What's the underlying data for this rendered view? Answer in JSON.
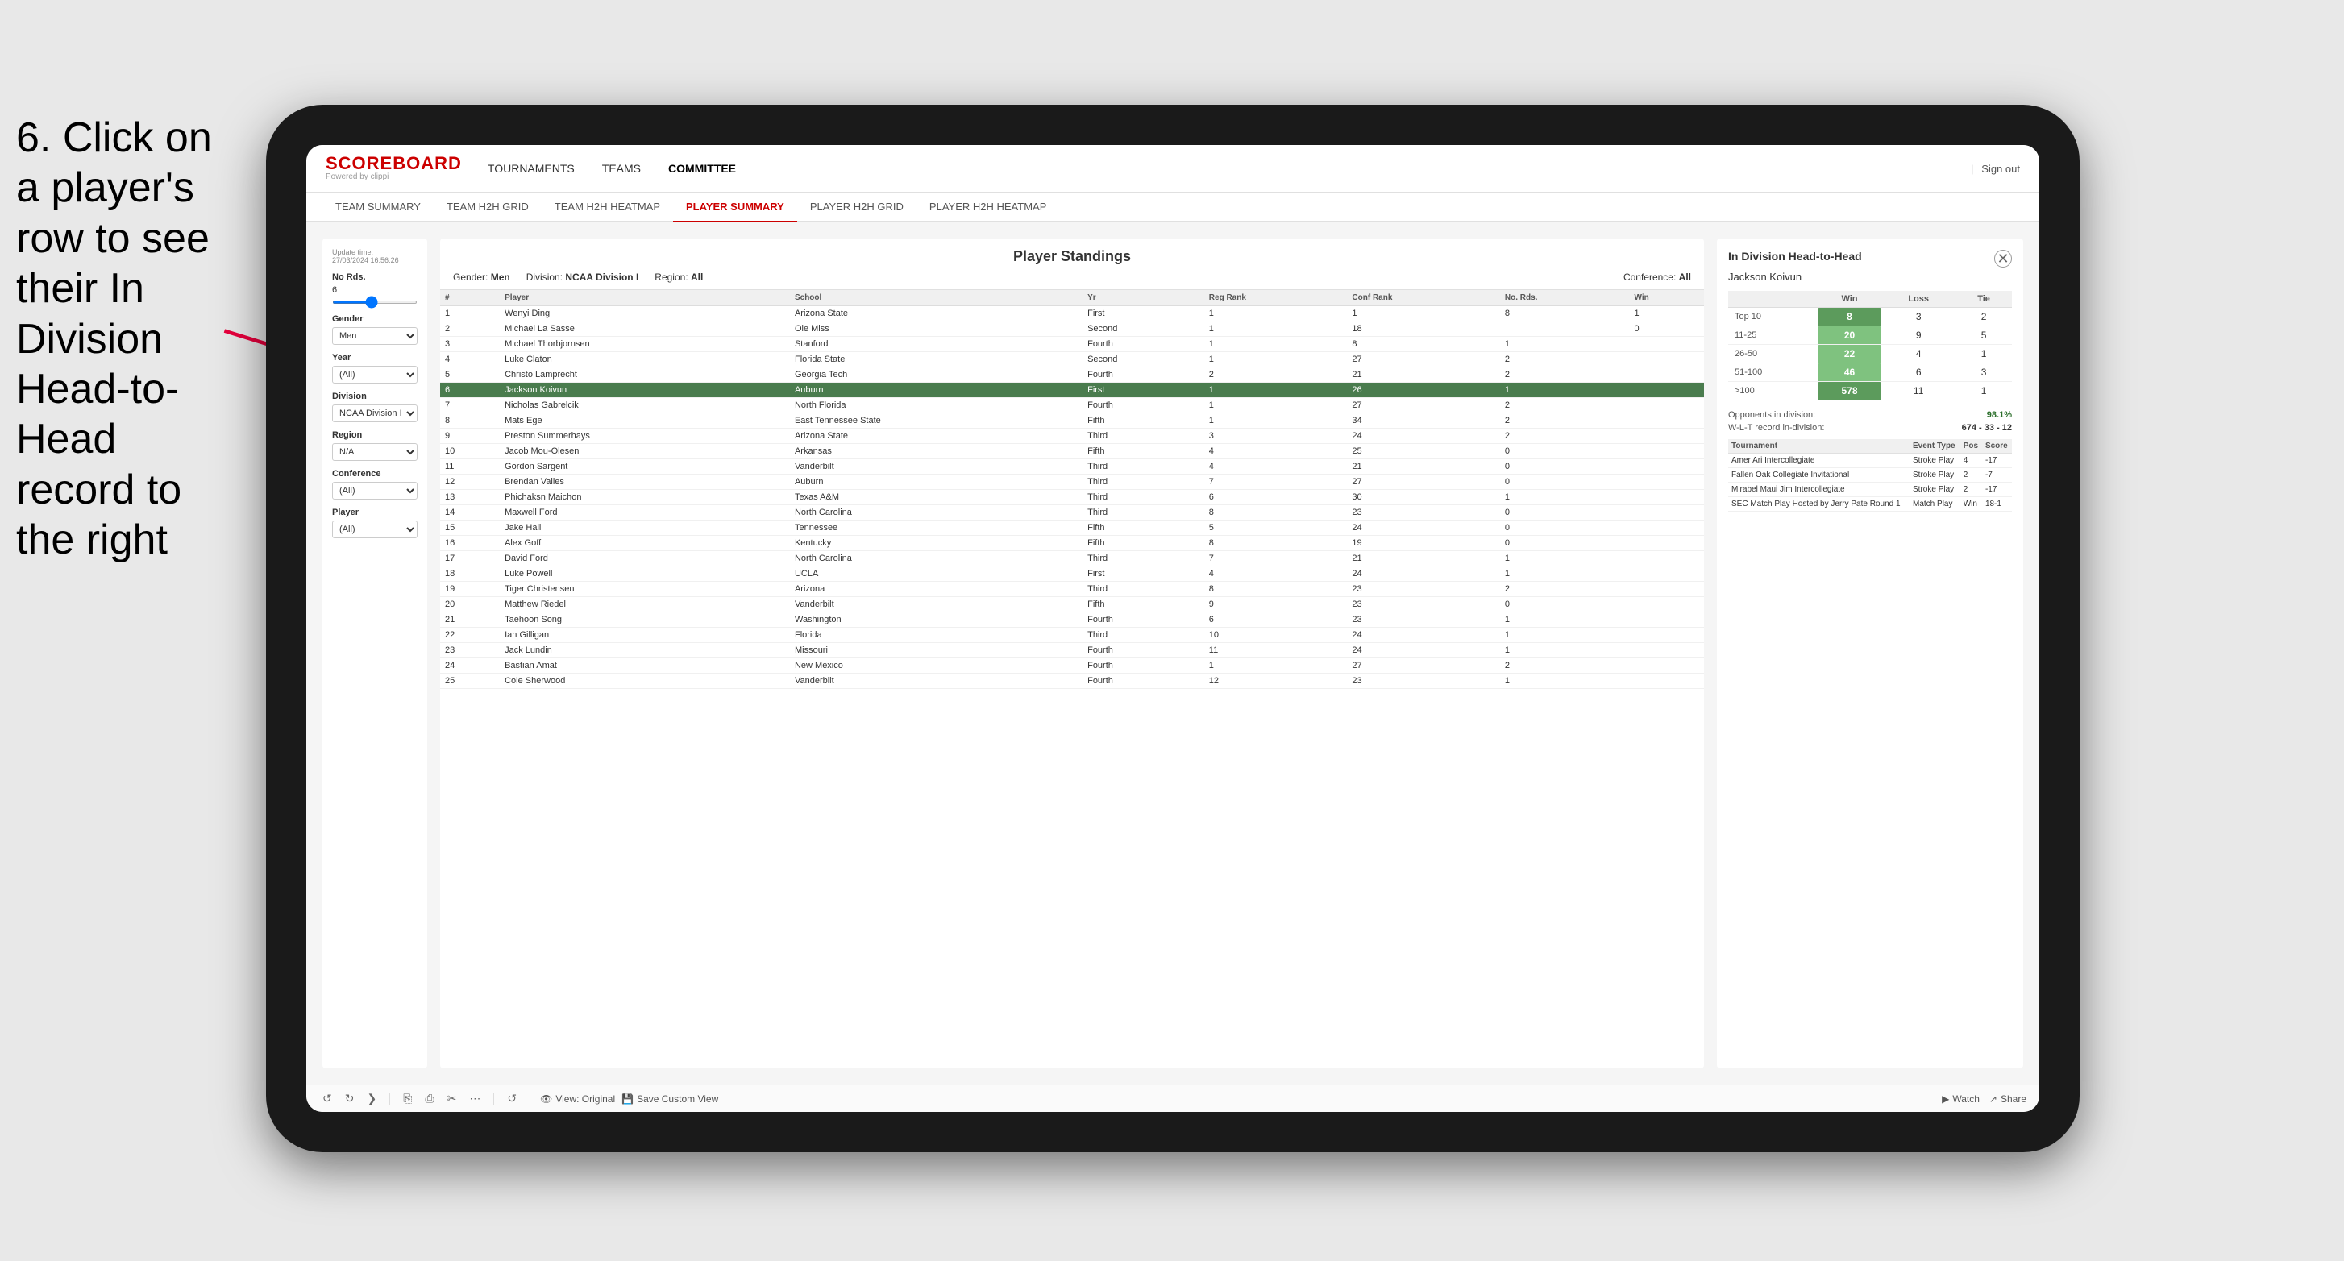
{
  "instruction": {
    "text": "6. Click on a player's row to see their In Division Head-to-Head record to the right"
  },
  "nav": {
    "logo": "SCOREBOARD",
    "powered_by": "Powered by clippi",
    "items": [
      "TOURNAMENTS",
      "TEAMS",
      "COMMITTEE"
    ],
    "sign_out": "Sign out"
  },
  "sub_nav": {
    "items": [
      "TEAM SUMMARY",
      "TEAM H2H GRID",
      "TEAM H2H HEATMAP",
      "PLAYER SUMMARY",
      "PLAYER H2H GRID",
      "PLAYER H2H HEATMAP"
    ],
    "active": "PLAYER SUMMARY"
  },
  "sidebar": {
    "update_time_label": "Update time:",
    "update_time": "27/03/2024 16:56:26",
    "no_rds_label": "No Rds.",
    "no_rds_value": "6",
    "gender_label": "Gender",
    "gender_value": "Men",
    "year_label": "Year",
    "year_value": "(All)",
    "division_label": "Division",
    "division_value": "NCAA Division I",
    "region_label": "Region",
    "region_value": "N/A",
    "conference_label": "Conference",
    "conference_value": "(All)",
    "player_label": "Player",
    "player_value": "(All)"
  },
  "standings": {
    "title": "Player Standings",
    "gender": "Men",
    "division": "NCAA Division I",
    "region": "All",
    "conference": "All",
    "columns": [
      "#",
      "Player",
      "School",
      "Yr",
      "Reg Rank",
      "Conf Rank",
      "No. Rds.",
      "Win"
    ],
    "rows": [
      {
        "num": "1",
        "player": "Wenyi Ding",
        "school": "Arizona State",
        "yr": "First",
        "reg": "1",
        "conf": "1",
        "rds": "8",
        "win": "1"
      },
      {
        "num": "2",
        "player": "Michael La Sasse",
        "school": "Ole Miss",
        "yr": "Second",
        "reg": "1",
        "conf": "18",
        "rds": "",
        "win": "0"
      },
      {
        "num": "3",
        "player": "Michael Thorbjornsen",
        "school": "Stanford",
        "yr": "Fourth",
        "reg": "1",
        "conf": "8",
        "rds": "1",
        "win": ""
      },
      {
        "num": "4",
        "player": "Luke Claton",
        "school": "Florida State",
        "yr": "Second",
        "reg": "1",
        "conf": "27",
        "rds": "2",
        "win": ""
      },
      {
        "num": "5",
        "player": "Christo Lamprecht",
        "school": "Georgia Tech",
        "yr": "Fourth",
        "reg": "2",
        "conf": "21",
        "rds": "2",
        "win": ""
      },
      {
        "num": "6",
        "player": "Jackson Koivun",
        "school": "Auburn",
        "yr": "First",
        "reg": "1",
        "conf": "26",
        "rds": "1",
        "win": "",
        "highlighted": true
      },
      {
        "num": "7",
        "player": "Nicholas Gabrelcik",
        "school": "North Florida",
        "yr": "Fourth",
        "reg": "1",
        "conf": "27",
        "rds": "2",
        "win": ""
      },
      {
        "num": "8",
        "player": "Mats Ege",
        "school": "East Tennessee State",
        "yr": "Fifth",
        "reg": "1",
        "conf": "34",
        "rds": "2",
        "win": ""
      },
      {
        "num": "9",
        "player": "Preston Summerhays",
        "school": "Arizona State",
        "yr": "Third",
        "reg": "3",
        "conf": "24",
        "rds": "2",
        "win": ""
      },
      {
        "num": "10",
        "player": "Jacob Mou-Olesen",
        "school": "Arkansas",
        "yr": "Fifth",
        "reg": "4",
        "conf": "25",
        "rds": "0",
        "win": ""
      },
      {
        "num": "11",
        "player": "Gordon Sargent",
        "school": "Vanderbilt",
        "yr": "Third",
        "reg": "4",
        "conf": "21",
        "rds": "0",
        "win": ""
      },
      {
        "num": "12",
        "player": "Brendan Valles",
        "school": "Auburn",
        "yr": "Third",
        "reg": "7",
        "conf": "27",
        "rds": "0",
        "win": ""
      },
      {
        "num": "13",
        "player": "Phichaksn Maichon",
        "school": "Texas A&M",
        "yr": "Third",
        "reg": "6",
        "conf": "30",
        "rds": "1",
        "win": ""
      },
      {
        "num": "14",
        "player": "Maxwell Ford",
        "school": "North Carolina",
        "yr": "Third",
        "reg": "8",
        "conf": "23",
        "rds": "0",
        "win": ""
      },
      {
        "num": "15",
        "player": "Jake Hall",
        "school": "Tennessee",
        "yr": "Fifth",
        "reg": "5",
        "conf": "24",
        "rds": "0",
        "win": ""
      },
      {
        "num": "16",
        "player": "Alex Goff",
        "school": "Kentucky",
        "yr": "Fifth",
        "reg": "8",
        "conf": "19",
        "rds": "0",
        "win": ""
      },
      {
        "num": "17",
        "player": "David Ford",
        "school": "North Carolina",
        "yr": "Third",
        "reg": "7",
        "conf": "21",
        "rds": "1",
        "win": ""
      },
      {
        "num": "18",
        "player": "Luke Powell",
        "school": "UCLA",
        "yr": "First",
        "reg": "4",
        "conf": "24",
        "rds": "1",
        "win": ""
      },
      {
        "num": "19",
        "player": "Tiger Christensen",
        "school": "Arizona",
        "yr": "Third",
        "reg": "8",
        "conf": "23",
        "rds": "2",
        "win": ""
      },
      {
        "num": "20",
        "player": "Matthew Riedel",
        "school": "Vanderbilt",
        "yr": "Fifth",
        "reg": "9",
        "conf": "23",
        "rds": "0",
        "win": ""
      },
      {
        "num": "21",
        "player": "Taehoon Song",
        "school": "Washington",
        "yr": "Fourth",
        "reg": "6",
        "conf": "23",
        "rds": "1",
        "win": ""
      },
      {
        "num": "22",
        "player": "Ian Gilligan",
        "school": "Florida",
        "yr": "Third",
        "reg": "10",
        "conf": "24",
        "rds": "1",
        "win": ""
      },
      {
        "num": "23",
        "player": "Jack Lundin",
        "school": "Missouri",
        "yr": "Fourth",
        "reg": "11",
        "conf": "24",
        "rds": "1",
        "win": ""
      },
      {
        "num": "24",
        "player": "Bastian Amat",
        "school": "New Mexico",
        "yr": "Fourth",
        "reg": "1",
        "conf": "27",
        "rds": "2",
        "win": ""
      },
      {
        "num": "25",
        "player": "Cole Sherwood",
        "school": "Vanderbilt",
        "yr": "Fourth",
        "reg": "12",
        "conf": "23",
        "rds": "1",
        "win": ""
      }
    ]
  },
  "h2h": {
    "title": "In Division Head-to-Head",
    "player": "Jackson Koivun",
    "table_headers": [
      "",
      "Win",
      "Loss",
      "Tie"
    ],
    "rows": [
      {
        "label": "Top 10",
        "win": "8",
        "loss": "3",
        "tie": "2",
        "win_color": "dark"
      },
      {
        "label": "11-25",
        "win": "20",
        "loss": "9",
        "tie": "5",
        "win_color": "medium"
      },
      {
        "label": "26-50",
        "win": "22",
        "loss": "4",
        "tie": "1",
        "win_color": "medium"
      },
      {
        "label": "51-100",
        "win": "46",
        "loss": "6",
        "tie": "3",
        "win_color": "medium"
      },
      {
        "label": ">100",
        "win": "578",
        "loss": "11",
        "tie": "1",
        "win_color": "dark"
      }
    ],
    "opponents_label": "Opponents in division:",
    "opponents_pct": "98.1%",
    "wl_label": "W-L-T record in-division:",
    "wl_value": "674 - 33 - 12",
    "tournament_headers": [
      "Tournament",
      "Event Type",
      "Pos",
      "Score"
    ],
    "tournament_rows": [
      {
        "tournament": "Amer Ari Intercollegiate",
        "type": "Stroke Play",
        "pos": "4",
        "score": "-17"
      },
      {
        "tournament": "Fallen Oak Collegiate Invitational",
        "type": "Stroke Play",
        "pos": "2",
        "score": "-7"
      },
      {
        "tournament": "Mirabel Maui Jim Intercollegiate",
        "type": "Stroke Play",
        "pos": "2",
        "score": "-17"
      },
      {
        "tournament": "SEC Match Play Hosted by Jerry Pate Round 1",
        "type": "Match Play",
        "pos": "Win",
        "score": "18-1"
      }
    ]
  },
  "toolbar": {
    "view_original": "View: Original",
    "save_custom": "Save Custom View",
    "watch": "Watch",
    "share": "Share"
  },
  "colors": {
    "red": "#cc0000",
    "green_dark": "#4a7c4e",
    "green_medium": "#7ab87a",
    "green_light": "#a8d4a8",
    "highlight_row": "#4a7c4e"
  }
}
